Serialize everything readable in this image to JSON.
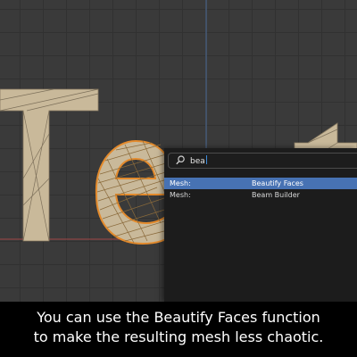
{
  "search": {
    "query": "bea",
    "results": [
      {
        "category": "Mesh:",
        "name": "Beautify Faces",
        "active": true
      },
      {
        "category": "Mesh:",
        "name": "Beam Builder",
        "active": false
      }
    ]
  },
  "caption": {
    "line1": "You can use the Beautify Faces function",
    "line2": "to make the resulting mesh less chaotic."
  },
  "colors": {
    "viewport_bg": "#3a3a3a",
    "grid_line": "#313131",
    "mesh_fill": "#c9b99a",
    "selection_orange": "#e38a2c",
    "highlight_blue": "#4772b3",
    "popup_bg": "#1c1c1c"
  },
  "icons": {
    "search": "magnifier-icon"
  }
}
